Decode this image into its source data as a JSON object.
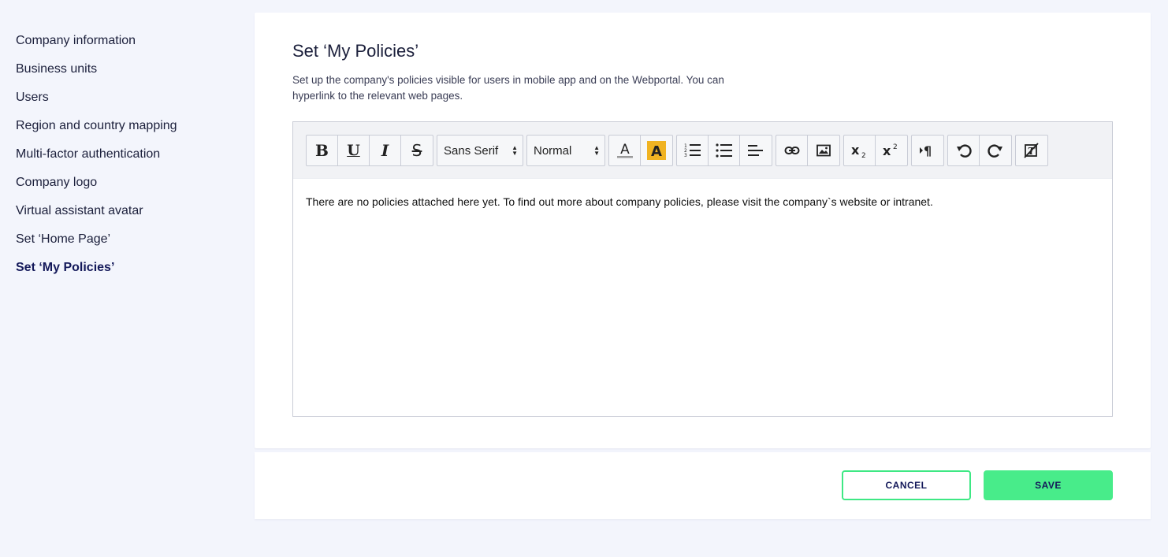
{
  "sidebar": {
    "items": [
      {
        "label": "Company information"
      },
      {
        "label": "Business units"
      },
      {
        "label": "Users"
      },
      {
        "label": "Region and country mapping"
      },
      {
        "label": "Multi-factor authentication"
      },
      {
        "label": "Company logo"
      },
      {
        "label": "Virtual assistant avatar"
      },
      {
        "label": "Set ‘Home Page’"
      },
      {
        "label": "Set ‘My Policies’",
        "active": true
      }
    ]
  },
  "main": {
    "title": "Set ‘My Policies’",
    "description": "Set up the company's policies visible for users in mobile app and on the Webportal. You can hyperlink to the relevant web pages."
  },
  "editor": {
    "font_select": "Sans Serif",
    "size_select": "Normal",
    "content": "There are no policies attached here yet. To find out more about company policies, please visit the company`s website or intranet.",
    "highlight_color": "#f0b323"
  },
  "footer": {
    "cancel_label": "CANCEL",
    "save_label": "SAVE"
  },
  "colors": {
    "accent": "#48ec8a",
    "navy": "#14195a",
    "background": "#f3f5fc"
  }
}
